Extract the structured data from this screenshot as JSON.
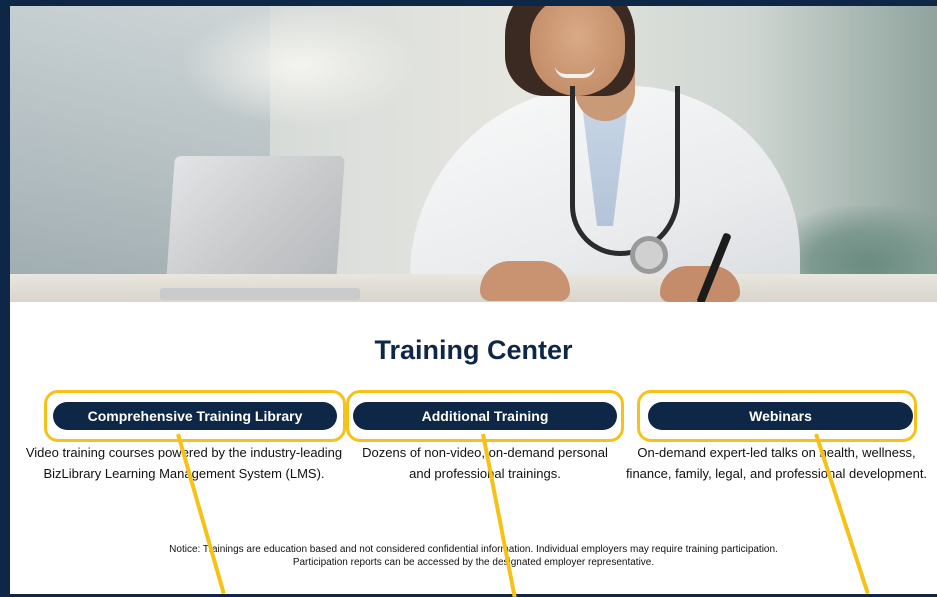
{
  "page": {
    "title": "Training Center"
  },
  "hero": {
    "image_icon": "doctor-laptop-photo"
  },
  "cards": [
    {
      "button_label": "Comprehensive Training Library",
      "description_line1": "Video training courses powered by the industry-leading",
      "description_line2": "BizLibrary Learning Management System (LMS)."
    },
    {
      "button_label": "Additional Training",
      "description_line1": "Dozens of non-video, on-demand personal",
      "description_line2": "and professional trainings."
    },
    {
      "button_label": "Webinars",
      "description_line1": "On-demand expert-led talks on health, wellness,",
      "description_line2": "finance, family, legal, and professional development."
    }
  ],
  "notice": {
    "line1": "Notice: Trainings are education based and not considered confidential information. Individual employers may require training participation.",
    "line2": "Participation reports can be accessed by the designated employer representative."
  },
  "colors": {
    "navy": "#0f2746",
    "highlight": "#f6c218"
  }
}
